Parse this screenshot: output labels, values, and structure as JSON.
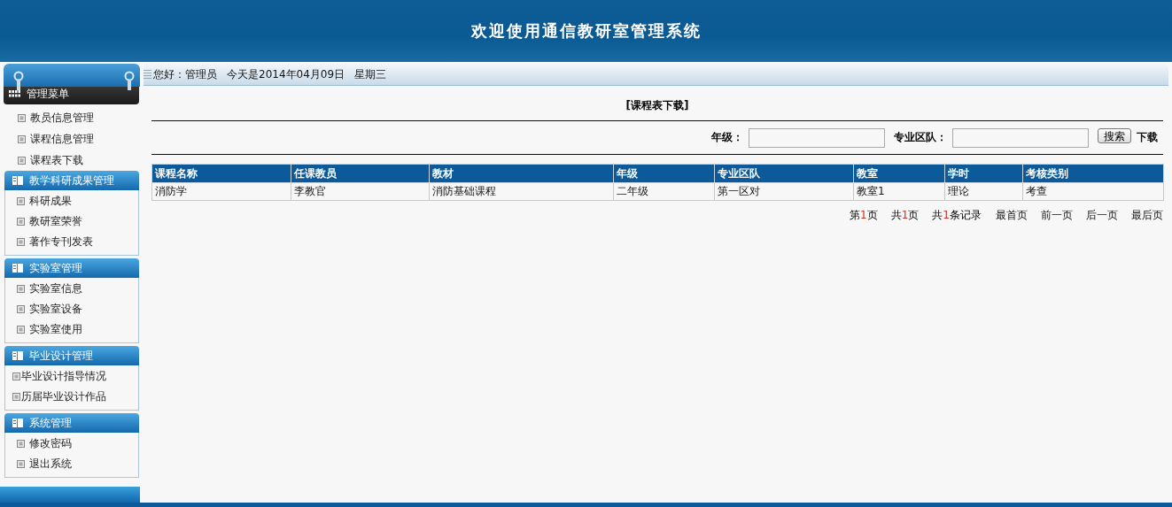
{
  "header": {
    "title": "欢迎使用通信教研室管理系统"
  },
  "topbar": {
    "greeting": "您好：管理员",
    "date": "今天是2014年04月09日",
    "weekday": "星期三"
  },
  "sidebar": {
    "groups": [
      {
        "kind": "main",
        "title": "管理菜单",
        "items": [
          "教员信息管理",
          "课程信息管理",
          "课程表下载"
        ]
      },
      {
        "kind": "section",
        "title": "教学科研成果管理",
        "items": [
          "科研成果",
          "教研室荣誉",
          "著作专刊发表"
        ]
      },
      {
        "kind": "section",
        "title": "实验室管理",
        "items": [
          "实验室信息",
          "实验室设备",
          "实验室使用"
        ]
      },
      {
        "kind": "section",
        "title": "毕业设计管理",
        "items": [
          "毕业设计指导情况",
          "历届毕业设计作品"
        ]
      },
      {
        "kind": "section",
        "title": "系统管理",
        "items": [
          "修改密码",
          "退出系统"
        ]
      }
    ]
  },
  "page_title": "[课程表下载]",
  "filters": [
    {
      "label": "年级："
    },
    {
      "label": "专业区队："
    }
  ],
  "search_button": "搜索",
  "download_link": "下载",
  "table": {
    "columns": [
      "课程名称",
      "任课教员",
      "教材",
      "年级",
      "专业区队",
      "教室",
      "学时",
      "考核类别"
    ],
    "rows": [
      [
        "消防学",
        "李教官",
        "消防基础课程",
        "二年级",
        "第一区对",
        "教室1",
        "理论",
        "考查"
      ]
    ]
  },
  "pagination": {
    "info": [
      {
        "before": "第",
        "number": "1",
        "after": "页"
      },
      {
        "before": "共",
        "number": "1",
        "after": "页"
      },
      {
        "before": "共",
        "number": "1",
        "after": "条记录"
      }
    ],
    "links": [
      "最首页",
      "前一页",
      "后一页",
      "最后页"
    ]
  }
}
